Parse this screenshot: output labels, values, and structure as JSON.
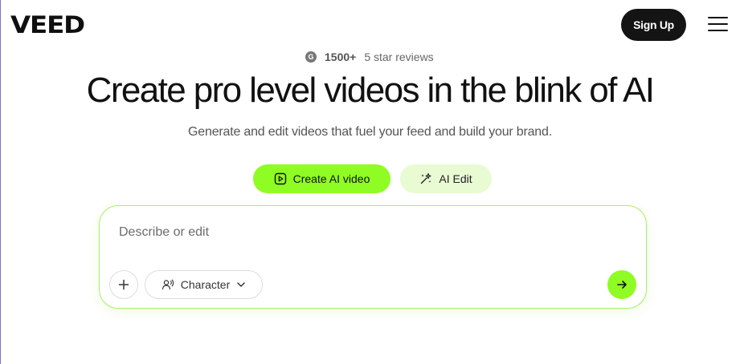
{
  "header": {
    "logo_text": "VEED",
    "signup_label": "Sign Up",
    "menu_icon": "hamburger-menu-icon"
  },
  "reviews": {
    "icon": "g2-logo-icon",
    "icon_letter": "G",
    "count": "1500+",
    "label": "5 star reviews"
  },
  "hero": {
    "title": "Create pro level videos in the blink of AI",
    "subtitle": "Generate and edit videos that fuel your feed and build your brand."
  },
  "modes": {
    "create": {
      "label": "Create AI video",
      "icon": "play-square-icon"
    },
    "edit": {
      "label": "AI Edit",
      "icon": "magic-sparkle-icon"
    }
  },
  "prompt": {
    "placeholder": "Describe or edit",
    "value": "",
    "add_icon": "plus-icon",
    "character_label": "Character",
    "character_icon": "user-voice-icon",
    "character_caret": "chevron-down-icon",
    "send_icon": "arrow-right-icon"
  },
  "colors": {
    "accent_green": "#8ffc23",
    "accent_green_light": "#e8fbd3",
    "dark": "#141414",
    "border_green": "#a8ef63"
  }
}
